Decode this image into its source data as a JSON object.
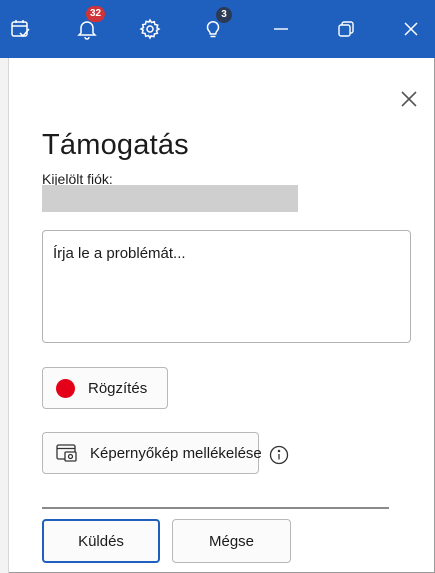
{
  "titlebar": {
    "bg_color": "#1f5fbd",
    "icons": {
      "calendar": "calendar-check-icon",
      "bell": "bell-icon",
      "gear": "gear-icon",
      "bulb": "lightbulb-icon",
      "minimize": "minimize-icon",
      "restore": "restore-icon",
      "close": "close-icon"
    },
    "notifications_badge": "32",
    "tips_badge": "3"
  },
  "panel": {
    "title": "Támogatás",
    "account_label": "Kijelölt fiók:",
    "problem_placeholder": "Írja le a problémát...",
    "record_label": "Rögzítés",
    "screenshot_label": "Képernyőkép mellékelése",
    "send_label": "Küldés",
    "cancel_label": "Mégse",
    "record_color": "#e50019",
    "accent_color": "#1f5fbd"
  }
}
